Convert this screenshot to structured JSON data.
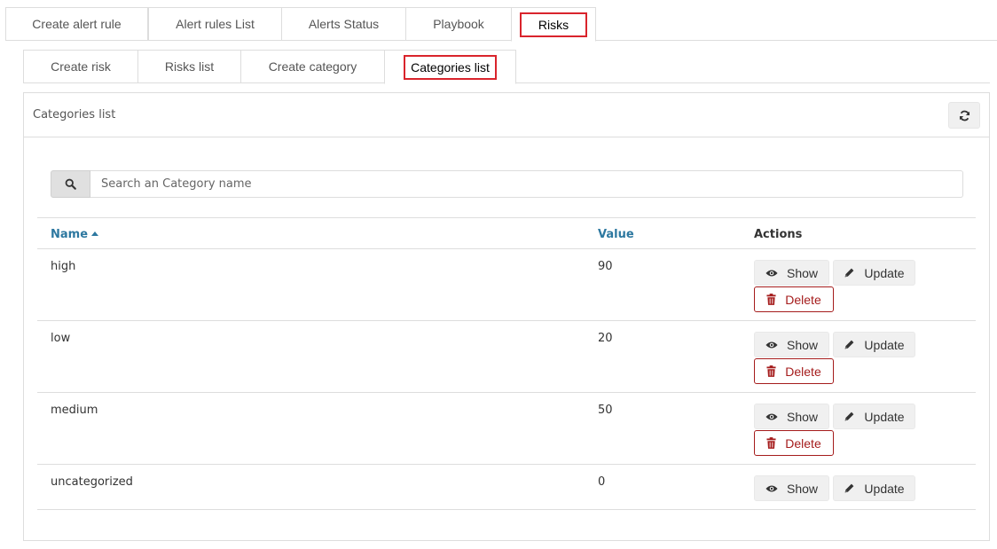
{
  "top_tabs": [
    {
      "label": "Create alert rule"
    },
    {
      "label": "Alert rules List"
    },
    {
      "label": "Alerts Status"
    },
    {
      "label": "Playbook"
    },
    {
      "label": "Risks"
    }
  ],
  "sub_tabs": [
    {
      "label": "Create risk"
    },
    {
      "label": "Risks list"
    },
    {
      "label": "Create category"
    },
    {
      "label": "Categories list"
    }
  ],
  "panel": {
    "title": "Categories list",
    "search_placeholder": "Search an Category name"
  },
  "table": {
    "headers": {
      "name": "Name",
      "value": "Value",
      "actions": "Actions"
    },
    "rows": [
      {
        "name": "high",
        "value": "90"
      },
      {
        "name": "low",
        "value": "20"
      },
      {
        "name": "medium",
        "value": "50"
      },
      {
        "name": "uncategorized",
        "value": "0"
      }
    ],
    "show_label": "Show",
    "update_label": "Update",
    "delete_label": "Delete"
  },
  "colors": {
    "highlight": "#d9242c",
    "link": "#2d78a0",
    "danger": "#a51c1c"
  },
  "icons": [
    "refresh-icon",
    "search-icon",
    "eye-icon",
    "pencil-icon",
    "trash-icon",
    "sort-asc-icon"
  ]
}
